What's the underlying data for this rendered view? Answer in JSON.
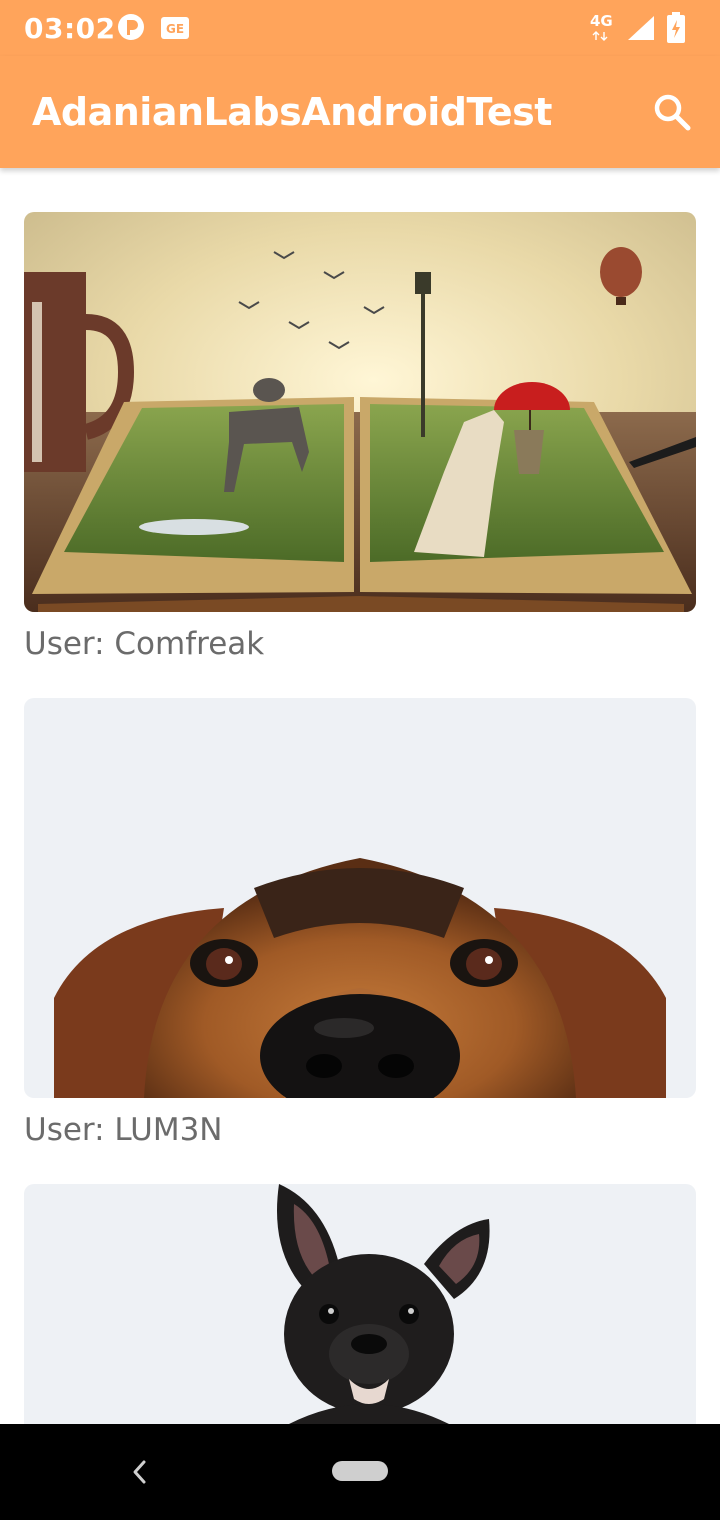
{
  "status_bar": {
    "time": "03:02",
    "network": "4G"
  },
  "app_bar": {
    "title": "AdanianLabsAndroidTest",
    "search_icon": "search-icon"
  },
  "feed": {
    "items": [
      {
        "caption": "User: Comfreak",
        "image": "fantasy-open-book-landscape"
      },
      {
        "caption": "User: LUM3N",
        "image": "dog-face-closeup"
      },
      {
        "caption": "",
        "image": "french-bulldog"
      }
    ]
  },
  "nav_bar": {
    "back_icon": "back-icon",
    "home_icon": "home-pill-icon"
  },
  "colors": {
    "primary": "#ffa45b",
    "caption_text": "#6b6b6b",
    "background": "#ffffff"
  }
}
